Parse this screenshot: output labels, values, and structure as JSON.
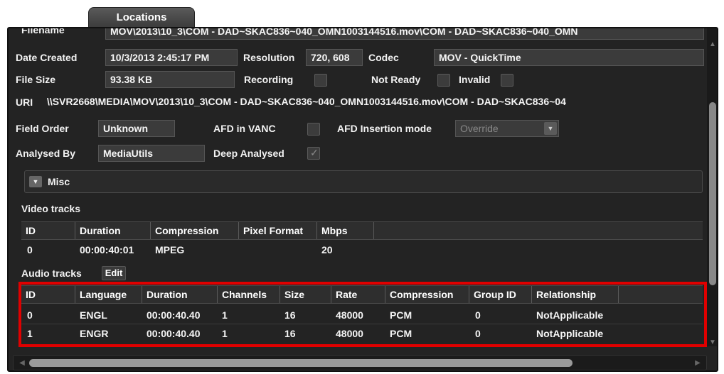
{
  "tab": {
    "label": "Locations"
  },
  "filename": {
    "label": "Filename",
    "value": "MOV\\2013\\10_3\\COM - DAD~SKAC836~040_OMN1003144516.mov\\COM - DAD~SKAC836~040_OMN"
  },
  "date_created": {
    "label": "Date Created",
    "value": "10/3/2013 2:45:17 PM"
  },
  "resolution": {
    "label": "Resolution",
    "value": "720, 608"
  },
  "codec": {
    "label": "Codec",
    "value": "MOV - QuickTime"
  },
  "file_size": {
    "label": "File Size",
    "value": "93.38 KB"
  },
  "recording": {
    "label": "Recording",
    "checked": false
  },
  "not_ready": {
    "label": "Not Ready",
    "checked": false
  },
  "invalid": {
    "label": "Invalid",
    "checked": false
  },
  "uri": {
    "label": "URI",
    "value": "\\\\SVR2668\\MEDIA\\MOV\\2013\\10_3\\COM - DAD~SKAC836~040_OMN1003144516.mov\\COM - DAD~SKAC836~04"
  },
  "field_order": {
    "label": "Field Order",
    "value": "Unknown"
  },
  "afd_in_vanc": {
    "label": "AFD in VANC",
    "checked": false
  },
  "afd_insertion_mode": {
    "label": "AFD Insertion mode",
    "value": "Override"
  },
  "analysed_by": {
    "label": "Analysed By",
    "value": "MediaUtils"
  },
  "deep_analysed": {
    "label": "Deep Analysed",
    "checked": true
  },
  "misc": {
    "label": "Misc"
  },
  "video_tracks": {
    "label": "Video tracks",
    "columns": [
      "ID",
      "Duration",
      "Compression",
      "Pixel Format",
      "Mbps"
    ],
    "rows": [
      {
        "id": "0",
        "duration": "00:00:40:01",
        "compression": "MPEG",
        "pixel_format": "",
        "mbps": "20"
      }
    ]
  },
  "audio_tracks": {
    "label": "Audio tracks",
    "edit_label": "Edit",
    "columns": [
      "ID",
      "Language",
      "Duration",
      "Channels",
      "Size",
      "Rate",
      "Compression",
      "Group ID",
      "Relationship"
    ],
    "rows": [
      {
        "id": "0",
        "language": "ENGL",
        "duration": "00:00:40.40",
        "channels": "1",
        "size": "16",
        "rate": "48000",
        "compression": "PCM",
        "group_id": "0",
        "relationship": "NotApplicable"
      },
      {
        "id": "1",
        "language": "ENGR",
        "duration": "00:00:40.40",
        "channels": "1",
        "size": "16",
        "rate": "48000",
        "compression": "PCM",
        "group_id": "0",
        "relationship": "NotApplicable"
      }
    ]
  },
  "colors": {
    "panel_bg": "#232323",
    "field_bg": "#3b3b3b",
    "highlight": "#e00000"
  },
  "icons": {
    "misc_toggle": "chevron-down-icon",
    "scroll_up": "arrow-up-icon",
    "scroll_down": "arrow-down-icon",
    "scroll_left": "arrow-left-icon",
    "scroll_right": "arrow-right-icon"
  }
}
